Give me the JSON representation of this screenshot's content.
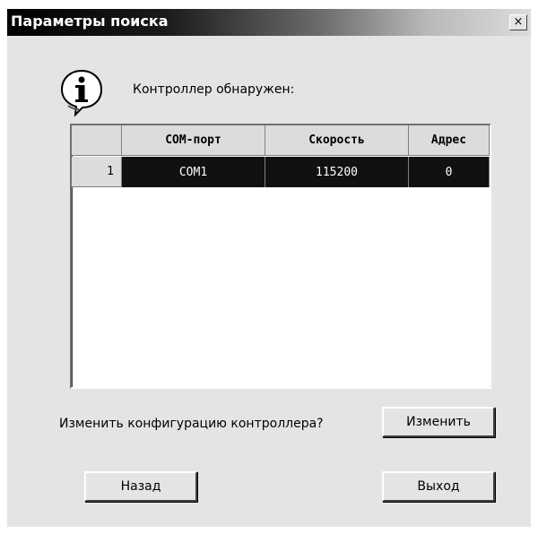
{
  "window": {
    "title": "Параметры поиска",
    "close_label": "×"
  },
  "message": "Контроллер обнаружен:",
  "grid": {
    "headers": [
      "",
      "COM-порт",
      "Скорость",
      "Адрес"
    ],
    "rows": [
      {
        "num": "1",
        "port": "COM1",
        "speed": "115200",
        "address": "0"
      }
    ]
  },
  "question": "Изменить конфигурацию контроллера?",
  "buttons": {
    "change": "Изменить",
    "back": "Назад",
    "exit": "Выход"
  },
  "icons": {
    "info": "info-icon",
    "close": "close-icon"
  }
}
